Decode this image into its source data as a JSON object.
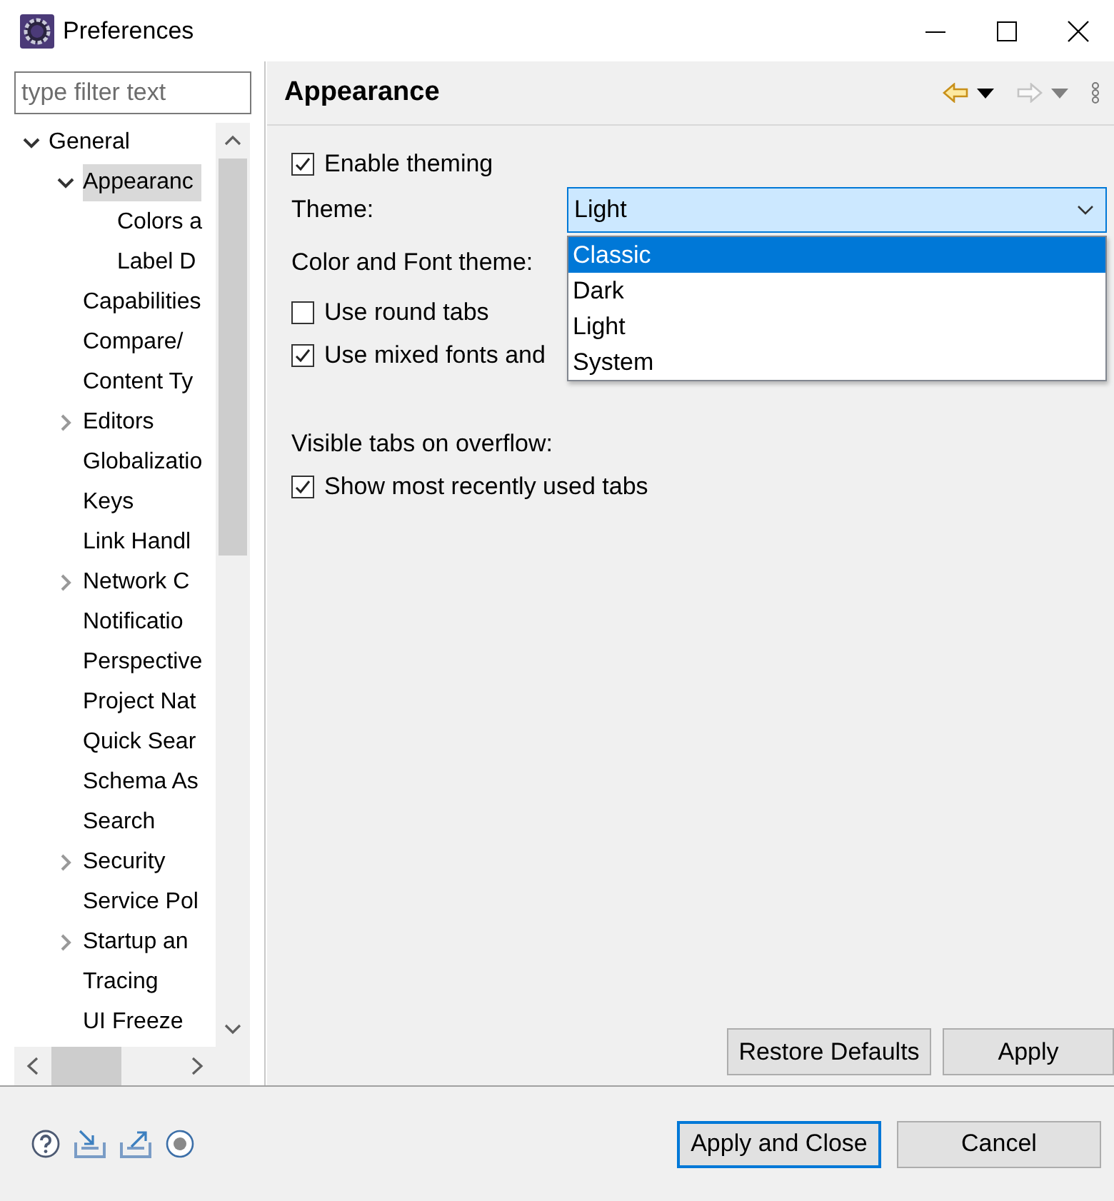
{
  "window": {
    "title": "Preferences"
  },
  "filter": {
    "placeholder": "type filter text"
  },
  "tree": [
    {
      "label": "General",
      "expanded": true,
      "selected": false,
      "children": [
        {
          "label": "Appearanc",
          "expanded": true,
          "selected": true,
          "children": [
            {
              "label": "Colors a",
              "selected": false
            },
            {
              "label": "Label D",
              "selected": false
            }
          ]
        },
        {
          "label": "Capabilities",
          "selected": false
        },
        {
          "label": "Compare/",
          "selected": false
        },
        {
          "label": "Content Ty",
          "selected": false
        },
        {
          "label": "Editors",
          "expanded": false,
          "selected": false
        },
        {
          "label": "Globalizatio",
          "selected": false
        },
        {
          "label": "Keys",
          "selected": false
        },
        {
          "label": "Link Handl",
          "selected": false
        },
        {
          "label": "Network C",
          "expanded": false,
          "selected": false
        },
        {
          "label": "Notificatio",
          "selected": false
        },
        {
          "label": "Perspective",
          "selected": false
        },
        {
          "label": "Project Nat",
          "selected": false
        },
        {
          "label": "Quick Sear",
          "selected": false
        },
        {
          "label": "Schema As",
          "selected": false
        },
        {
          "label": "Search",
          "selected": false
        },
        {
          "label": "Security",
          "expanded": false,
          "selected": false
        },
        {
          "label": "Service Pol",
          "selected": false
        },
        {
          "label": "Startup an",
          "expanded": false,
          "selected": false
        },
        {
          "label": "Tracing",
          "selected": false
        },
        {
          "label": "UI Freeze",
          "selected": false
        }
      ]
    }
  ],
  "page": {
    "title": "Appearance",
    "settings": [
      {
        "kind": "checkbox",
        "label": "Enable theming",
        "checked": true
      },
      {
        "kind": "combo",
        "label": "Theme:",
        "value": "Light",
        "expanded": true,
        "options": [
          {
            "label": "Classic",
            "highlighted": true
          },
          {
            "label": "Dark",
            "highlighted": false
          },
          {
            "label": "Light",
            "highlighted": false
          },
          {
            "label": "System",
            "highlighted": false
          }
        ]
      },
      {
        "kind": "label",
        "label": "Color and Font theme:"
      },
      {
        "kind": "checkbox",
        "label": "Use round tabs",
        "checked": false
      },
      {
        "kind": "checkbox",
        "label": "Use mixed fonts and",
        "checked": true
      },
      {
        "kind": "section",
        "label": "Visible tabs on overflow:"
      },
      {
        "kind": "checkbox",
        "label": "Show most recently used tabs",
        "checked": true
      }
    ],
    "buttons": [
      {
        "label": "Restore Defaults"
      },
      {
        "label": "Apply"
      }
    ]
  },
  "footer": {
    "buttons": [
      {
        "label": "Apply and Close",
        "default": true
      },
      {
        "label": "Cancel",
        "default": false
      }
    ]
  }
}
